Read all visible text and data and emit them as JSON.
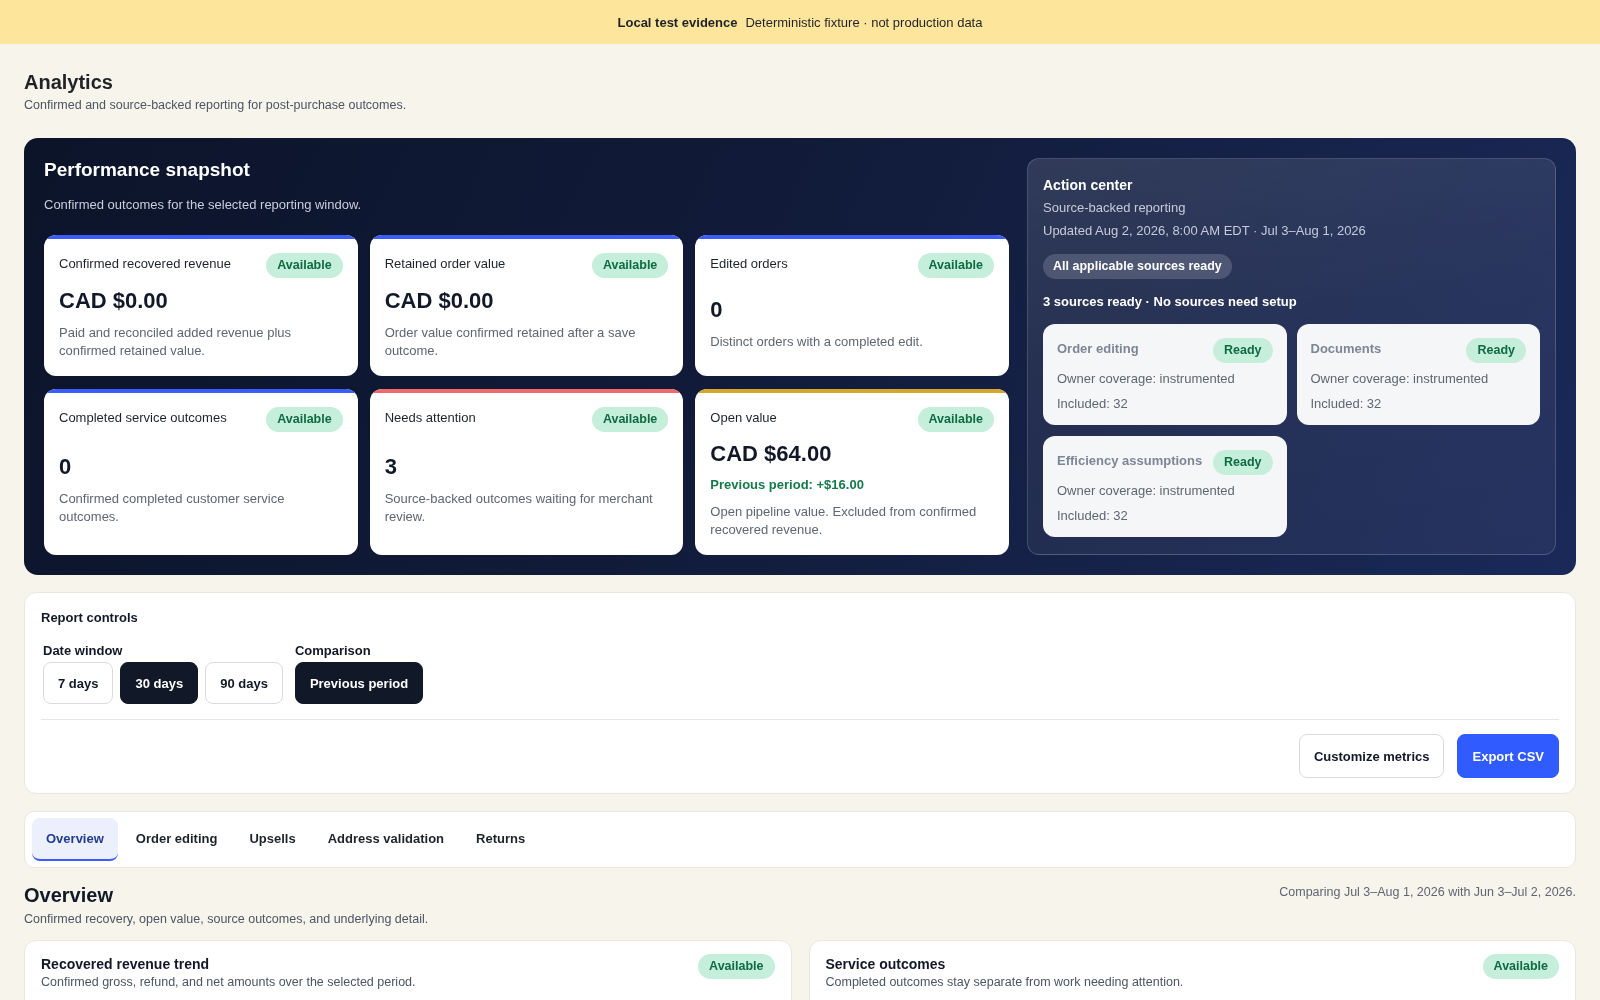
{
  "banner": {
    "title": "Local test evidence",
    "text": "Deterministic fixture · not production data"
  },
  "header": {
    "title": "Analytics",
    "subtitle": "Confirmed and source-backed reporting for post-purchase outcomes."
  },
  "snapshot": {
    "title": "Performance snapshot",
    "subtitle": "Confirmed outcomes for the selected reporting window.",
    "metrics": [
      {
        "label": "Confirmed recovered revenue",
        "badge": "Available",
        "value": "CAD $0.00",
        "description": "Paid and reconciled added revenue plus confirmed retained value.",
        "color": "#3b5bfd"
      },
      {
        "label": "Retained order value",
        "badge": "Available",
        "value": "CAD $0.00",
        "description": "Order value confirmed retained after a save outcome.",
        "color": "#3b5bfd"
      },
      {
        "label": "Edited orders",
        "badge": "Available",
        "value": "0",
        "description": "Distinct orders with a completed edit.",
        "color": "#3b5bfd"
      },
      {
        "label": "Completed service outcomes",
        "badge": "Available",
        "value": "0",
        "description": "Confirmed completed customer service outcomes.",
        "color": "#3b5bfd"
      },
      {
        "label": "Needs attention",
        "badge": "Available",
        "value": "3",
        "description": "Source-backed outcomes waiting for merchant review.",
        "color": "#f06a6a"
      },
      {
        "label": "Open value",
        "badge": "Available",
        "value": "CAD $64.00",
        "comparison": "Previous period: +$16.00",
        "description": "Open pipeline value. Excluded from confirmed recovered revenue.",
        "color": "#d4a72c"
      }
    ]
  },
  "action_center": {
    "title": "Action center",
    "subtitle": "Source-backed reporting",
    "updated": "Updated Aug 2, 2026, 8:00 AM EDT · Jul 3–Aug 1, 2026",
    "status": "All applicable sources ready",
    "summary": "3 sources ready · No sources need setup",
    "sources": [
      {
        "name": "Order editing",
        "badge": "Ready",
        "coverage": "Owner coverage: instrumented",
        "included": "Included: 32"
      },
      {
        "name": "Documents",
        "badge": "Ready",
        "coverage": "Owner coverage: instrumented",
        "included": "Included: 32"
      },
      {
        "name": "Efficiency assumptions",
        "badge": "Ready",
        "coverage": "Owner coverage: instrumented",
        "included": "Included: 32"
      }
    ]
  },
  "report_controls": {
    "title": "Report controls",
    "groups": [
      {
        "label": "Date window",
        "options": [
          {
            "label": "7 days",
            "selected": false
          },
          {
            "label": "30 days",
            "selected": true
          },
          {
            "label": "90 days",
            "selected": false
          }
        ]
      },
      {
        "label": "Comparison",
        "options": [
          {
            "label": "Previous period",
            "selected": true
          }
        ]
      }
    ],
    "actions": [
      {
        "label": "Customize metrics",
        "kind": "secondary"
      },
      {
        "label": "Export CSV",
        "kind": "primary"
      }
    ]
  },
  "tabs": [
    {
      "label": "Overview",
      "selected": true
    },
    {
      "label": "Order editing",
      "selected": false
    },
    {
      "label": "Upsells",
      "selected": false
    },
    {
      "label": "Address validation",
      "selected": false
    },
    {
      "label": "Returns",
      "selected": false
    }
  ],
  "overview": {
    "title": "Overview",
    "subtitle": "Confirmed recovery, open value, source outcomes, and underlying detail.",
    "comparison_note": "Comparing Jul 3–Aug 1, 2026 with Jun 3–Jul 2, 2026.",
    "cards": [
      {
        "title": "Recovered revenue trend",
        "badge": "Available",
        "subtitle": "Confirmed gross, refund, and net amounts over the selected period."
      },
      {
        "title": "Service outcomes",
        "badge": "Available",
        "subtitle": "Completed outcomes stay separate from work needing attention."
      }
    ]
  }
}
